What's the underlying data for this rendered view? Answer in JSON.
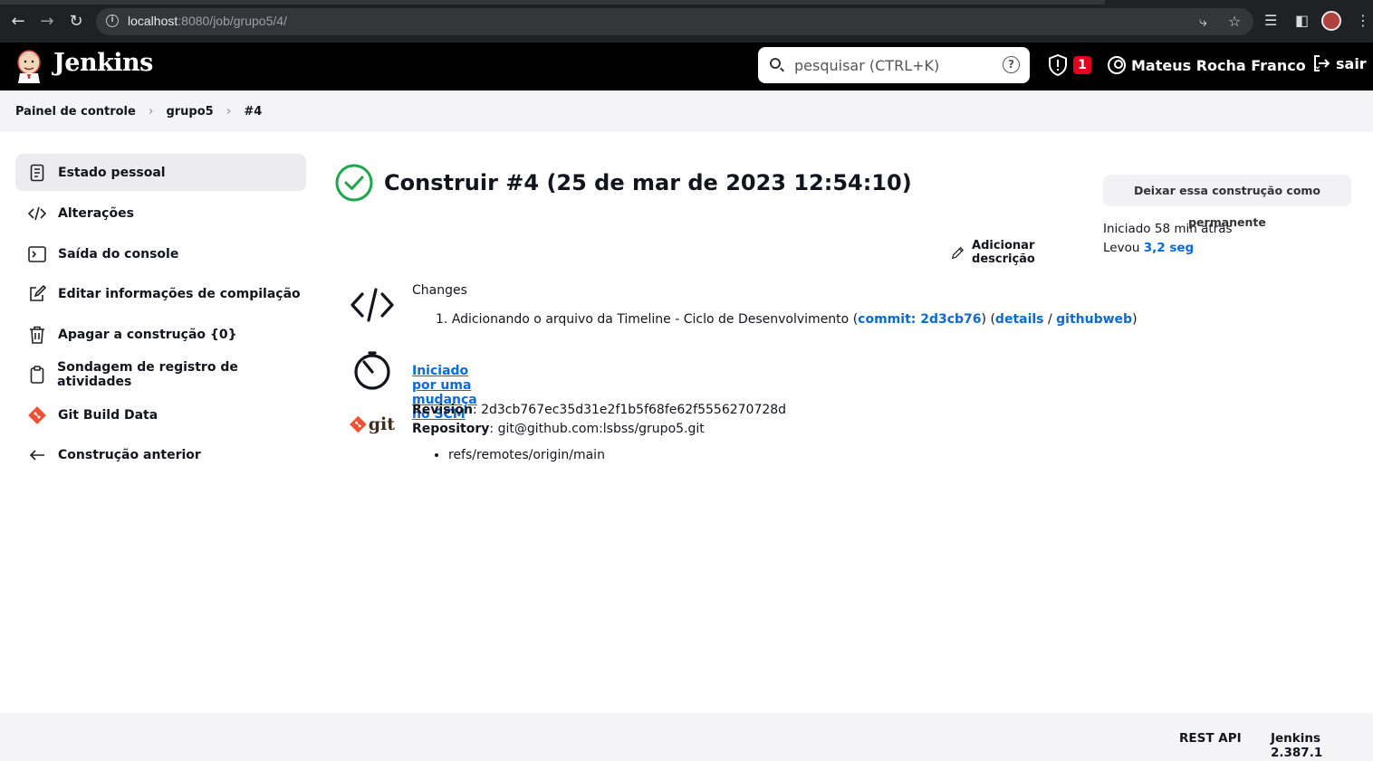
{
  "browser": {
    "url_host": "localhost",
    "url_rest": ":8080/job/grupo5/4/"
  },
  "header": {
    "app_title": "Jenkins",
    "search_placeholder": "pesquisar (CTRL+K)",
    "security_count": "1",
    "user_name": "Mateus Rocha Franco",
    "logout_label": "sair"
  },
  "breadcrumb": [
    "Painel de controle",
    "grupo5",
    "#4"
  ],
  "sidebar": {
    "items": [
      {
        "label": "Estado pessoal",
        "icon": "document-icon"
      },
      {
        "label": "Alterações",
        "icon": "code-icon"
      },
      {
        "label": "Saída do console",
        "icon": "terminal-icon"
      },
      {
        "label": "Editar informações de compilação",
        "icon": "edit-icon"
      },
      {
        "label": "Apagar a construção {0}",
        "icon": "trash-icon"
      },
      {
        "label": "Sondagem de registro de atividades",
        "icon": "clipboard-icon"
      },
      {
        "label": "Git Build Data",
        "icon": "git-icon"
      },
      {
        "label": "Construção anterior",
        "icon": "arrow-left-icon"
      }
    ]
  },
  "build": {
    "title": "Construir #4 (25 de mar de 2023 12:54:10)",
    "status": "success",
    "add_description_label": "Adicionar descrição",
    "changes": {
      "heading": "Changes",
      "items": [
        {
          "number": "1.",
          "message": "Adicionando o arquivo da Timeline - Ciclo de Desenvolvimento",
          "commit_label": "commit: 2d3cb76",
          "details_label": "details",
          "githubweb_label": "githubweb"
        }
      ]
    },
    "trigger_label": "Iniciado por uma mudança no SCM",
    "git": {
      "logo_text": "git",
      "revision_label": "Revision",
      "revision": "2d3cb767ec35d31e2f1b5f68fe62f5556270728d",
      "repository_label": "Repository",
      "repository": "git@github.com:lsbss/grupo5.git",
      "branches": [
        "refs/remotes/origin/main"
      ]
    }
  },
  "side_panel": {
    "keep_button_label": "Deixar essa construção como permanente",
    "started_label": "Iniciado 58 min atrás",
    "took_prefix": "Levou",
    "duration": "3,2 seg"
  },
  "footer": {
    "rest_api_label": "REST API",
    "version_label": "Jenkins 2.387.1"
  },
  "colors": {
    "success": "#1ea64b",
    "link": "#0b6ad4",
    "badge": "#e6001f",
    "git_orange": "#f05133"
  }
}
